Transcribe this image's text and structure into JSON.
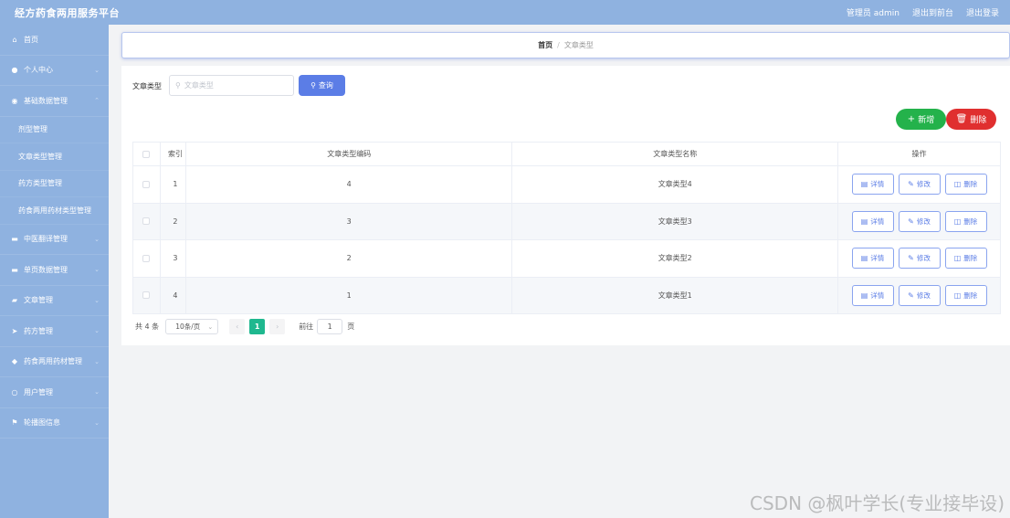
{
  "header": {
    "title": "经方药食两用服务平台",
    "admin": "管理员 admin",
    "to_front": "退出到前台",
    "logout": "退出登录"
  },
  "sidebar": {
    "items": [
      {
        "label": "首页",
        "icon": "home-icon",
        "glyph": "⌂"
      },
      {
        "label": "个人中心",
        "icon": "user-icon",
        "glyph": "●"
      },
      {
        "label": "基础数据管理",
        "icon": "database-icon",
        "glyph": "◉",
        "expanded": true
      },
      {
        "label": "中医翻译管理",
        "icon": "translate-icon",
        "glyph": "▬"
      },
      {
        "label": "单页数据管理",
        "icon": "page-icon",
        "glyph": "▬"
      },
      {
        "label": "文章管理",
        "icon": "folder-icon",
        "glyph": "▰"
      },
      {
        "label": "药方管理",
        "icon": "send-icon",
        "glyph": "➤"
      },
      {
        "label": "药食两用药材管理",
        "icon": "shield-icon",
        "glyph": "◆"
      },
      {
        "label": "用户管理",
        "icon": "users-icon",
        "glyph": "○"
      },
      {
        "label": "轮播图信息",
        "icon": "flag-icon",
        "glyph": "⚑"
      }
    ],
    "sub_items": [
      "剂型管理",
      "文章类型管理",
      "药方类型管理",
      "药食两用药材类型管理"
    ]
  },
  "breadcrumb": {
    "home": "首页",
    "separator": "/",
    "current": "文章类型"
  },
  "search": {
    "label": "文章类型",
    "placeholder": "文章类型",
    "button_label": "查询"
  },
  "actions": {
    "add_label": "新增",
    "delete_label": "删除"
  },
  "table": {
    "headers": {
      "index": "索引",
      "code": "文章类型编码",
      "name": "文章类型名称",
      "ops": "操作"
    },
    "rows": [
      {
        "index": "1",
        "code": "4",
        "name": "文章类型4"
      },
      {
        "index": "2",
        "code": "3",
        "name": "文章类型3"
      },
      {
        "index": "3",
        "code": "2",
        "name": "文章类型2"
      },
      {
        "index": "4",
        "code": "1",
        "name": "文章类型1"
      }
    ],
    "op_labels": {
      "detail": "详情",
      "edit": "修改",
      "delete": "删除"
    }
  },
  "pagination": {
    "total": "共 4 条",
    "page_size": "10条/页",
    "current_page": "1",
    "goto_label": "前往",
    "goto_value": "1",
    "page_unit": "页"
  },
  "watermark": "CSDN @枫叶学长(专业接毕设)",
  "colors": {
    "theme": "#8fb2e0",
    "primary": "#5b7de6",
    "success": "#24b24b",
    "danger": "#e02f2f",
    "page_active": "#1fb88f"
  }
}
